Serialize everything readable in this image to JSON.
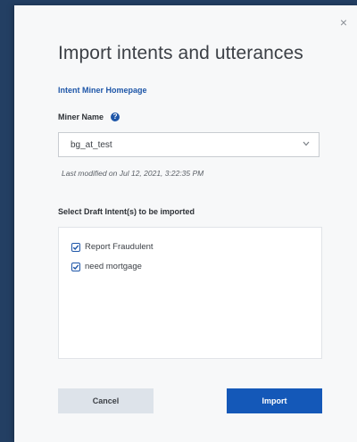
{
  "dialog": {
    "title": "Import intents and utterances",
    "close_glyph": "×",
    "homepage_link": "Intent Miner Homepage",
    "miner_name_label": "Miner Name",
    "help_glyph": "?",
    "miner_select": {
      "value": "bg_at_test",
      "chevron_glyph": "⌄"
    },
    "last_modified": "Last modified on Jul 12, 2021, 3:22:35 PM",
    "drafts_label": "Select Draft Intent(s) to be imported",
    "drafts": [
      {
        "label": "Report Fraudulent",
        "checked": true
      },
      {
        "label": "need mortgage",
        "checked": true
      }
    ],
    "cancel_label": "Cancel",
    "import_label": "Import"
  },
  "colors": {
    "accent": "#1458b8",
    "backdrop": "#233f63",
    "dialog_bg": "#f7f8f9",
    "cancel_bg": "#dde3ea"
  },
  "icons": {
    "close": "close-icon",
    "help": "help-circle-icon",
    "dropdown": "chevron-down-icon",
    "checkbox": "checkbox-checked-icon"
  }
}
